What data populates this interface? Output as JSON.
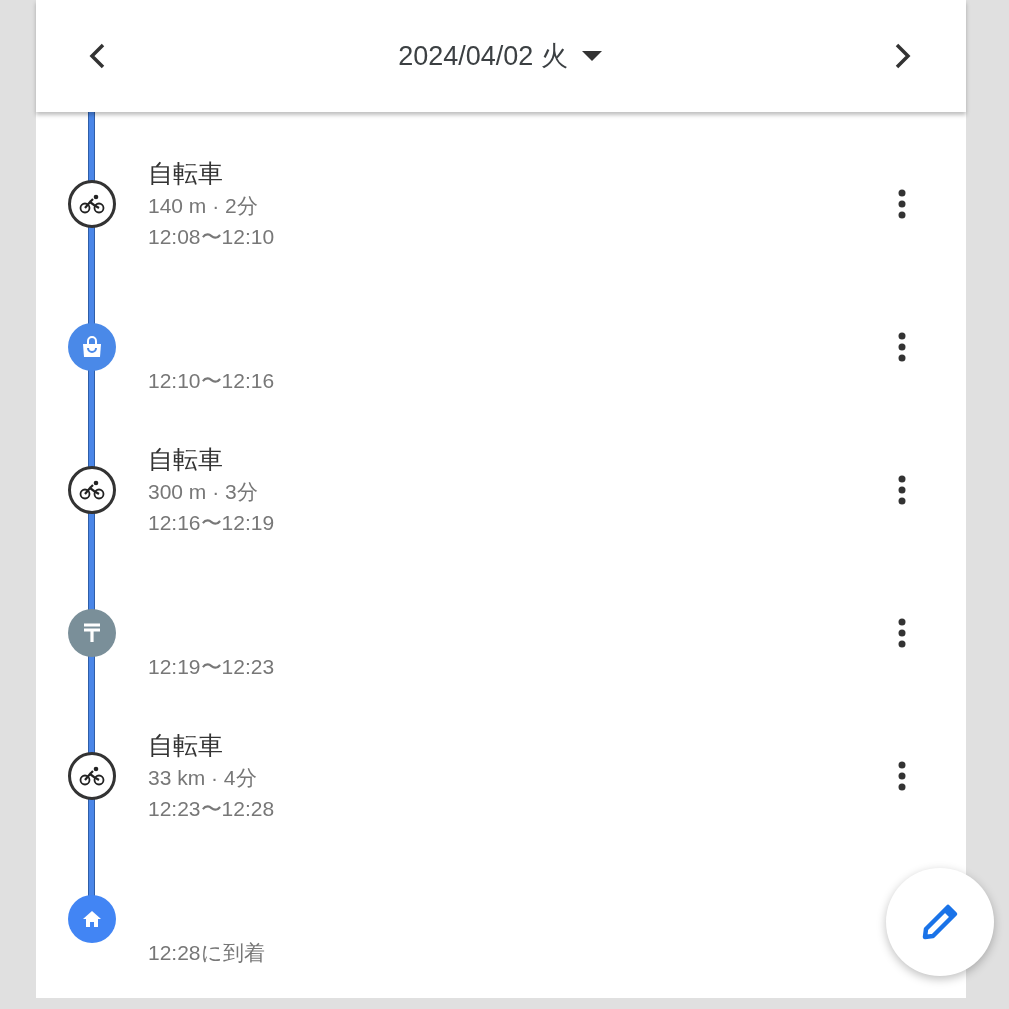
{
  "header": {
    "date": "2024/04/02 火"
  },
  "timeline": [
    {
      "kind": "cycling",
      "title": "自転車",
      "detail": "140 m · 2分",
      "time": "12:08〜12:10"
    },
    {
      "kind": "shopping",
      "color": "#4a89e8",
      "time": "12:10〜12:16"
    },
    {
      "kind": "cycling",
      "title": "自転車",
      "detail": "300 m · 3分",
      "time": "12:16〜12:19"
    },
    {
      "kind": "post",
      "color": "#7a8f99",
      "time": "12:19〜12:23"
    },
    {
      "kind": "cycling",
      "title": "自転車",
      "detail": "33 km · 4分",
      "time": "12:23〜12:28"
    },
    {
      "kind": "home",
      "color": "#4285f4",
      "time": "12:28に到着"
    }
  ]
}
